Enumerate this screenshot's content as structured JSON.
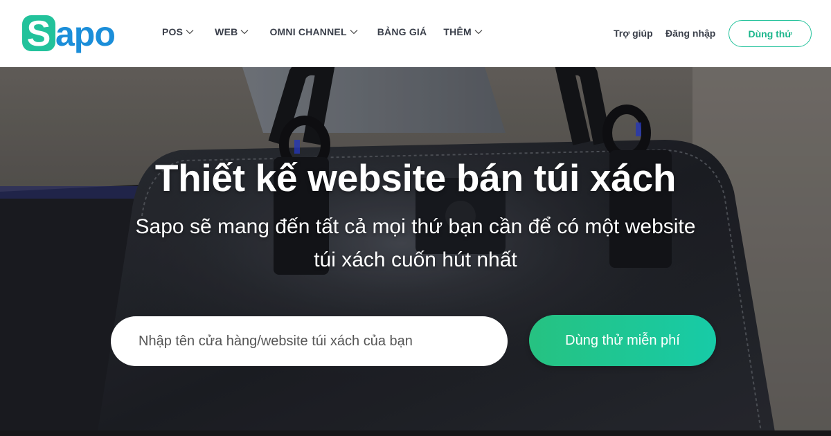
{
  "brand": {
    "name": "Sapo",
    "colors": {
      "logo_green": "#22c29b",
      "logo_blue": "#1b8ed9",
      "accent": "#1bb68c"
    }
  },
  "nav": {
    "items": [
      {
        "label": "POS",
        "has_dropdown": true
      },
      {
        "label": "WEB",
        "has_dropdown": true
      },
      {
        "label": "OMNI CHANNEL",
        "has_dropdown": true
      },
      {
        "label": "BẢNG GIÁ",
        "has_dropdown": false
      },
      {
        "label": "THÊM",
        "has_dropdown": true
      }
    ],
    "help_label": "Trợ giúp",
    "login_label": "Đăng nhập",
    "trial_label": "Dùng thử"
  },
  "hero": {
    "title": "Thiết kế website bán túi xách",
    "subtitle_line1": "Sapo sẽ mang đến tất cả mọi thứ bạn cần để có một website",
    "subtitle_line2": "túi xách cuốn hút nhất",
    "input_placeholder": "Nhập tên cửa hàng/website túi xách của bạn",
    "cta_label": "Dùng thử miễn phí",
    "background": "handbag-photo"
  }
}
